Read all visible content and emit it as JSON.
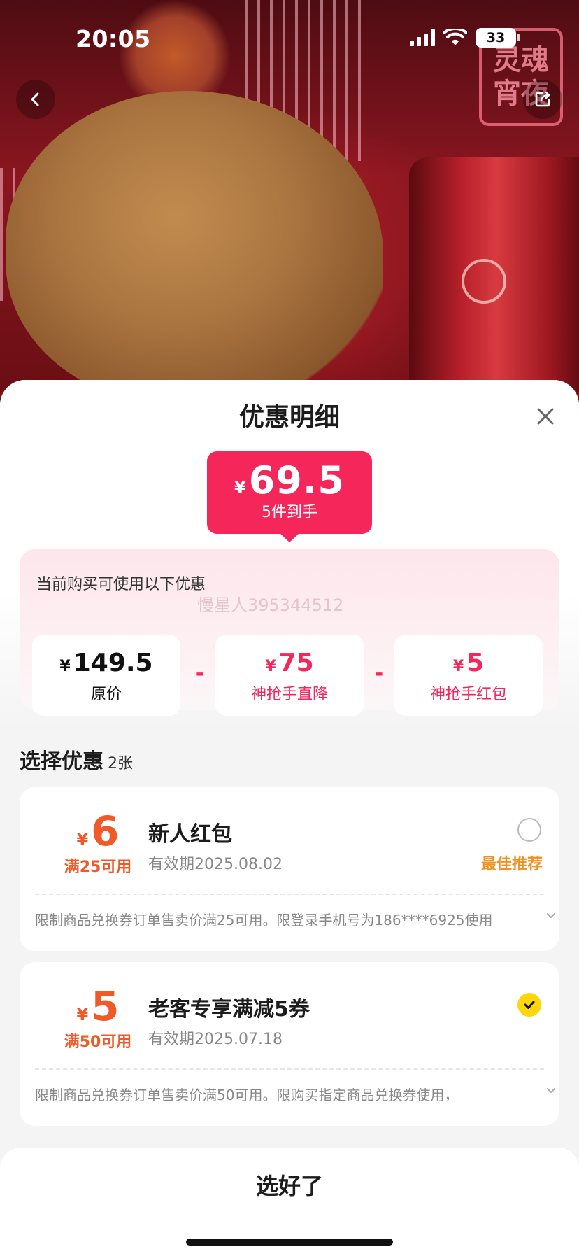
{
  "status_bar": {
    "time": "20:05",
    "battery": "33"
  },
  "hero": {
    "neon_line1": "灵魂",
    "neon_line2": "宵夜"
  },
  "sheet": {
    "title": "优惠明细",
    "price": {
      "currency": "¥",
      "amount": "69.5",
      "subtitle": "5件到手"
    },
    "breakdown": {
      "label": "当前购买可使用以下优惠",
      "watermark": "慢星人395344512",
      "minus": "-",
      "items": [
        {
          "currency": "¥",
          "amount": "149.5",
          "label": "原价"
        },
        {
          "currency": "¥",
          "amount": "75",
          "label": "神抢手直降"
        },
        {
          "currency": "¥",
          "amount": "5",
          "label": "神抢手红包"
        }
      ]
    },
    "select": {
      "title": "选择优惠",
      "count": "2张"
    },
    "coupons": [
      {
        "currency": "¥",
        "amount": "6",
        "condition": "满25可用",
        "name": "新人红包",
        "expiry": "有效期2025.08.02",
        "recommend": "最佳推荐",
        "selected": false,
        "terms": "限制商品兑换券订单售卖价满25可用。限登录手机号为186****6925使用"
      },
      {
        "currency": "¥",
        "amount": "5",
        "condition": "满50可用",
        "name": "老客专享满减5券",
        "expiry": "有效期2025.07.18",
        "selected": true,
        "terms": "限制商品兑换券订单售卖价满50可用。限购买指定商品兑换券使用，"
      }
    ],
    "confirm_label": "选好了"
  },
  "colors": {
    "accent": "#f5265a",
    "coupon": "#f05a28",
    "recommend": "#f0901e",
    "check": "#ffd60a"
  }
}
